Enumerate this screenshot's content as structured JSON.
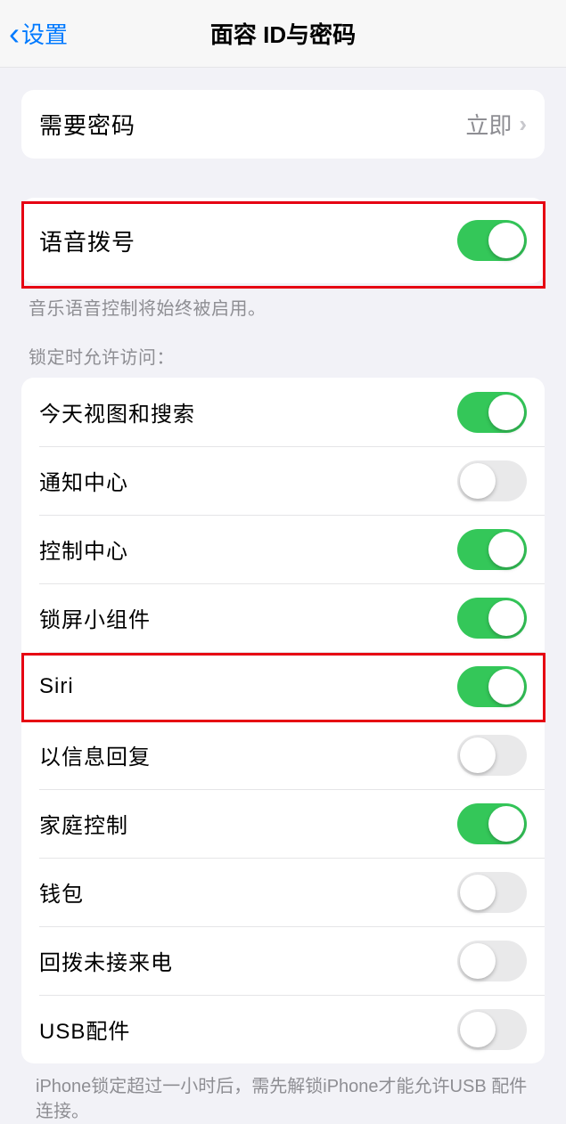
{
  "nav": {
    "back_label": "设置",
    "title": "面容 ID与密码"
  },
  "passcode": {
    "label": "需要密码",
    "value": "立即"
  },
  "voice": {
    "label": "语音拨号",
    "footer": "音乐语音控制将始终被启用。"
  },
  "lock": {
    "header": "锁定时允许访问：",
    "items": [
      {
        "label": "今天视图和搜索",
        "on": true
      },
      {
        "label": "通知中心",
        "on": false
      },
      {
        "label": "控制中心",
        "on": true
      },
      {
        "label": "锁屏小组件",
        "on": true
      },
      {
        "label": "Siri",
        "on": true
      },
      {
        "label": "以信息回复",
        "on": false
      },
      {
        "label": "家庭控制",
        "on": true
      },
      {
        "label": "钱包",
        "on": false
      },
      {
        "label": "回拨未接来电",
        "on": false
      },
      {
        "label": "USB配件",
        "on": false
      }
    ],
    "footer": "iPhone锁定超过一小时后，需先解锁iPhone才能允许USB 配件连接。"
  },
  "voice_on": true
}
